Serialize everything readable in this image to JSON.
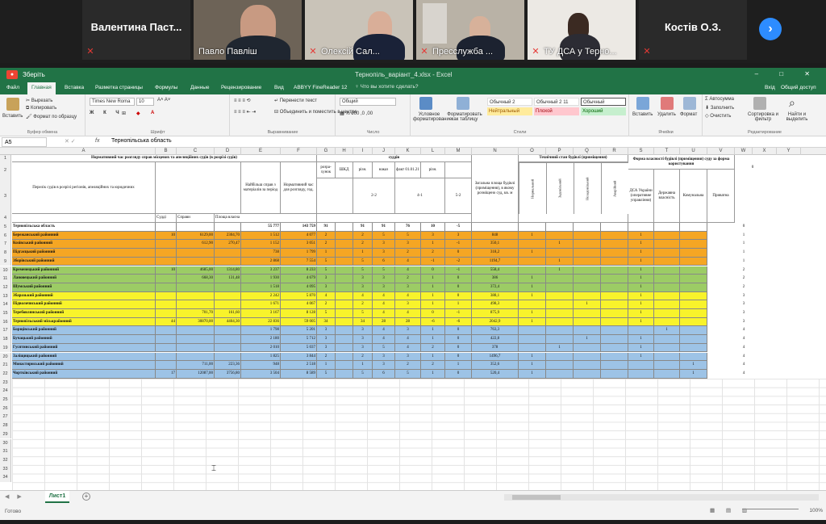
{
  "call": {
    "participants": [
      {
        "name": "Валентина  Паст...",
        "muted": true
      },
      {
        "name": "Павло Павліш",
        "muted": false
      },
      {
        "name": "Олексій Сал...",
        "muted": true
      },
      {
        "name": "Пресслужба ...",
        "muted": true
      },
      {
        "name": "ТУ ДСА у Терно...",
        "muted": true
      },
      {
        "name": "Костів О.З.",
        "muted": true
      }
    ],
    "next_icon": "chevron-right-icon"
  },
  "excel": {
    "autosave": "Зберіть",
    "doc_title": "Тернопіль_варіант_4.xlsx  -  Excel",
    "window_controls": "–  □  ✕",
    "tabs": [
      "Файл",
      "Главная",
      "Вставка",
      "Разметка страницы",
      "Формулы",
      "Данные",
      "Рецензирование",
      "Вид",
      "ABBYY FineReader 12"
    ],
    "active_tab": "Главная",
    "tell_me": "♀ Что вы хотите сделать?",
    "sign_in": "Вхід",
    "share": "Общий доступ",
    "ribbon": {
      "paste": "Вставить",
      "cut": "Вырезать",
      "copy": "Копировать",
      "format_painter": "Формат по образцу",
      "clipboard": "Буфер обмена",
      "font_name": "Times New Roma",
      "font_size": "10",
      "font_group": "Шрифт",
      "wrap_text": "Перенести текст",
      "merge": "Объединить и поместить в центре",
      "align_group": "Выравнивание",
      "number_format": "Общий",
      "number_group": "Число",
      "cond_format": "Условное форматирование",
      "format_table": "Форматировать как таблицу",
      "styles_group": "Стили",
      "style_normal2": "Обычный 2",
      "style_normal211": "Обычный 2 11",
      "style_normal": "Обычный",
      "style_neutral": "Нейтральный",
      "style_bad": "Плохой",
      "style_good": "Хороший",
      "insert": "Вставить",
      "delete": "Удалить",
      "format": "Формат",
      "cells_group": "Ячейки",
      "autosum": "Автосумма",
      "fill": "Заполнить",
      "clear": "Очистить",
      "sort": "Сортировка и фильтр",
      "find": "Найти и выделить",
      "edit_group": "Редактирование"
    },
    "formula": {
      "namebox": "A5",
      "fx": "fx",
      "content": "Тернопільська область"
    },
    "columns": [
      "A",
      "B",
      "C",
      "D",
      "E",
      "F",
      "G",
      "H",
      "I",
      "J",
      "K",
      "L",
      "M",
      "N",
      "O",
      "P",
      "Q",
      "R",
      "S",
      "T",
      "U",
      "V",
      "W",
      "X",
      "Y"
    ],
    "header": {
      "title_left": "Нормативний час розгляду справ місцевих та апеляційних судів (в розрізі судів)",
      "courts": "суддів",
      "left_label": "Перелік судів в розрізі регіонів, апеляційних та юридичних",
      "norm_load": "Найбільш справ з матеріалів за період",
      "norm_time": "Нормативний час для розгляду, год.",
      "g_hdr": "розра-хунок",
      "h_hdr": "ШКД",
      "i_hdr": "різн.",
      "j_hdr": "наказ",
      "k_hdr": "факт 01.01.21",
      "l_hdr": "різн.",
      "area_hdr": "Загальна площа будівлі (приміщення), в якому розміщено суд, кв. м",
      "tech_hdr": "Технічний стан будівлі (приміщення)",
      "t1": "Нормальний",
      "t2": "Задовільний",
      "t3": "Незадовільний",
      "t4": "Аварійний",
      "own_hdr": "Форма власності будівлі (приміщення) суду за форма користування",
      "o1": "ДСА України (оперативне управління)",
      "o2": "Державна власність",
      "o3": "Комунальна",
      "o4": "Приватна",
      "m22": "2-2",
      "m41": "4-1",
      "m52": "5-2",
      "row4": [
        "Судді",
        "Справи",
        "Площа власна"
      ],
      "w_zero": "0"
    },
    "rows": [
      {
        "n": "5",
        "name": "Тернопільська область",
        "b": "",
        "c": "",
        "d": "",
        "e": "55 777",
        "f": "143 759",
        "g": "91",
        "h": "",
        "i": "91",
        "j": "91",
        "k": "76",
        "l": "10",
        "m": "-5",
        "nn": "",
        "o": "",
        "p": "",
        "q": "",
        "r": "",
        "s": "",
        "t": "",
        "u": "",
        "w": "0",
        "color": "#ffffff"
      },
      {
        "n": "6",
        "name": "Бережанський районний",
        "b": "10",
        "c": "6129,00",
        "d": "2304,70",
        "e": "1 512",
        "f": "4 077",
        "g": "2",
        "h": "",
        "i": "2",
        "j": "5",
        "k": "5",
        "l": "3",
        "m": "3",
        "nn": "848",
        "o": "1",
        "p": "",
        "q": "",
        "r": "",
        "s": "1",
        "t": "",
        "u": "",
        "w": "1",
        "color": "#f5a623"
      },
      {
        "n": "7",
        "name": "Козівський районний",
        "b": "",
        "c": "612,90",
        "d": "270,47",
        "e": "1 152",
        "f": "3 051",
        "g": "2",
        "h": "",
        "i": "2",
        "j": "3",
        "k": "3",
        "l": "1",
        "m": "-1",
        "nn": "350,1",
        "o": "",
        "p": "1",
        "q": "",
        "r": "",
        "s": "1",
        "t": "",
        "u": "",
        "w": "1",
        "color": "#f5a623"
      },
      {
        "n": "8",
        "name": "Підгаєцький районний",
        "b": "",
        "c": "",
        "d": "",
        "e": "738",
        "f": "1 799",
        "g": "1",
        "h": "",
        "i": "1",
        "j": "3",
        "k": "2",
        "l": "2",
        "m": "0",
        "nn": "318,2",
        "o": "1",
        "p": "",
        "q": "",
        "r": "",
        "s": "1",
        "t": "",
        "u": "",
        "w": "1",
        "color": "#f5a623"
      },
      {
        "n": "9",
        "name": "Зборівський районний",
        "b": "",
        "c": "",
        "d": "",
        "e": "2 868",
        "f": "7 554",
        "g": "5",
        "h": "",
        "i": "5",
        "j": "6",
        "k": "4",
        "l": "-1",
        "m": "-2",
        "nn": "1194,7",
        "o": "",
        "p": "1",
        "q": "",
        "r": "",
        "s": "1",
        "t": "",
        "u": "",
        "w": "1",
        "color": "#f5a623"
      },
      {
        "n": "10",
        "name": "Кременецький районний",
        "b": "10",
        "c": "4685,00",
        "d": "1314,80",
        "e": "3 237",
        "f": "8 233",
        "g": "5",
        "h": "",
        "i": "5",
        "j": "5",
        "k": "4",
        "l": "0",
        "m": "-1",
        "nn": "558,4",
        "o": "",
        "p": "1",
        "q": "",
        "r": "",
        "s": "1",
        "t": "",
        "u": "",
        "w": "2",
        "color": "#9ccc65"
      },
      {
        "n": "11",
        "name": "Лановецький районний",
        "b": "",
        "c": "668,30",
        "d": "131,48",
        "e": "1 930",
        "f": "4 679",
        "g": "3",
        "h": "",
        "i": "3",
        "j": "3",
        "k": "2",
        "l": "1",
        "m": "0",
        "nn": "386",
        "o": "1",
        "p": "",
        "q": "",
        "r": "",
        "s": "1",
        "t": "",
        "u": "",
        "w": "2",
        "color": "#9ccc65"
      },
      {
        "n": "12",
        "name": "Шумський районний",
        "b": "",
        "c": "",
        "d": "",
        "e": "1 518",
        "f": "4 095",
        "g": "3",
        "h": "",
        "i": "3",
        "j": "3",
        "k": "3",
        "l": "1",
        "m": "0",
        "nn": "372,4",
        "o": "1",
        "p": "",
        "q": "",
        "r": "",
        "s": "1",
        "t": "",
        "u": "",
        "w": "2",
        "color": "#9ccc65"
      },
      {
        "n": "13",
        "name": "Збаразький районний",
        "b": "",
        "c": "",
        "d": "",
        "e": "2 242",
        "f": "5 870",
        "g": "4",
        "h": "",
        "i": "4",
        "j": "4",
        "k": "4",
        "l": "1",
        "m": "0",
        "nn": "388,1",
        "o": "1",
        "p": "",
        "q": "",
        "r": "",
        "s": "1",
        "t": "",
        "u": "",
        "w": "3",
        "color": "#f8f32b"
      },
      {
        "n": "14",
        "name": "Підволочиський районний",
        "b": "",
        "c": "",
        "d": "",
        "e": "1 671",
        "f": "4 067",
        "g": "2",
        "h": "",
        "i": "2",
        "j": "4",
        "k": "3",
        "l": "1",
        "m": "1",
        "nn": "498,3",
        "o": "",
        "p": "",
        "q": "1",
        "r": "",
        "s": "1",
        "t": "",
        "u": "",
        "w": "3",
        "color": "#f8f32b"
      },
      {
        "n": "15",
        "name": "Теребовлянський районний",
        "b": "",
        "c": "701,70",
        "d": "161,60",
        "e": "3 167",
        "f": "8 128",
        "g": "5",
        "h": "",
        "i": "5",
        "j": "4",
        "k": "4",
        "l": "0",
        "m": "-1",
        "nn": "875,9",
        "o": "1",
        "p": "",
        "q": "",
        "r": "",
        "s": "1",
        "t": "",
        "u": "",
        "w": "3",
        "color": "#f8f32b"
      },
      {
        "n": "16",
        "name": "Тернопільський міськрайонний",
        "b": "44",
        "c": "30870,00",
        "d": "4404,30",
        "e": "22 836",
        "f": "59 005",
        "g": "34",
        "h": "",
        "i": "34",
        "j": "28",
        "k": "28",
        "l": "-6",
        "m": "-6",
        "nn": "2042,9",
        "o": "1",
        "p": "",
        "q": "",
        "r": "",
        "s": "1",
        "t": "",
        "u": "",
        "w": "3",
        "color": "#f8f32b"
      },
      {
        "n": "17",
        "name": "Борщівський районний",
        "b": "",
        "c": "",
        "d": "",
        "e": "1 798",
        "f": "5 201",
        "g": "3",
        "h": "",
        "i": "3",
        "j": "4",
        "k": "3",
        "l": "1",
        "m": "0",
        "nn": "763,3",
        "o": "",
        "p": "",
        "q": "",
        "r": "",
        "s": "",
        "t": "1",
        "u": "",
        "w": "4",
        "color": "#9dc3e6"
      },
      {
        "n": "18",
        "name": "Бучацький районний",
        "b": "",
        "c": "",
        "d": "",
        "e": "2 180",
        "f": "5 712",
        "g": "3",
        "h": "",
        "i": "3",
        "j": "4",
        "k": "4",
        "l": "1",
        "m": "0",
        "nn": "422,8",
        "o": "",
        "p": "",
        "q": "1",
        "r": "",
        "s": "1",
        "t": "",
        "u": "",
        "w": "4",
        "color": "#9dc3e6"
      },
      {
        "n": "19",
        "name": "Гусятинський районний",
        "b": "",
        "c": "",
        "d": "",
        "e": "2 010",
        "f": "5 037",
        "g": "3",
        "h": "",
        "i": "3",
        "j": "5",
        "k": "4",
        "l": "2",
        "m": "0",
        "nn": "378",
        "o": "",
        "p": "1",
        "q": "",
        "r": "",
        "s": "1",
        "t": "",
        "u": "",
        "w": "4",
        "color": "#9dc3e6"
      },
      {
        "n": "20",
        "name": "Заліщицький районний",
        "b": "",
        "c": "",
        "d": "",
        "e": "1 825",
        "f": "3 844",
        "g": "2",
        "h": "",
        "i": "2",
        "j": "3",
        "k": "3",
        "l": "1",
        "m": "0",
        "nn": "1496,7",
        "o": "1",
        "p": "",
        "q": "",
        "r": "",
        "s": "1",
        "t": "",
        "u": "",
        "w": "4",
        "color": "#9dc3e6"
      },
      {
        "n": "21",
        "name": "Монастириський районний",
        "b": "",
        "c": "711,00",
        "d": "223,36",
        "e": "948",
        "f": "2 518",
        "g": "1",
        "h": "",
        "i": "1",
        "j": "3",
        "k": "2",
        "l": "2",
        "m": "1",
        "nn": "352,6",
        "o": "1",
        "p": "",
        "q": "",
        "r": "",
        "s": "",
        "t": "",
        "u": "1",
        "w": "4",
        "color": "#9dc3e6"
      },
      {
        "n": "22",
        "name": "Чортківський районний",
        "b": "17",
        "c": "12087,00",
        "d": "3756,80",
        "e": "3 504",
        "f": "8 589",
        "g": "5",
        "h": "",
        "i": "5",
        "j": "6",
        "k": "5",
        "l": "1",
        "m": "0",
        "nn": "520,4",
        "o": "1",
        "p": "",
        "q": "",
        "r": "",
        "s": "",
        "t": "",
        "u": "1",
        "w": "4",
        "color": "#9dc3e6"
      }
    ],
    "empty_rows": [
      "23",
      "24",
      "25",
      "26",
      "27",
      "28",
      "29",
      "30",
      "31",
      "32",
      "33",
      "34"
    ],
    "header_rows": [
      "1",
      "2",
      "3",
      "4"
    ],
    "sheet_tab": "Лист1",
    "status": "Готово",
    "zoom": "100%"
  }
}
